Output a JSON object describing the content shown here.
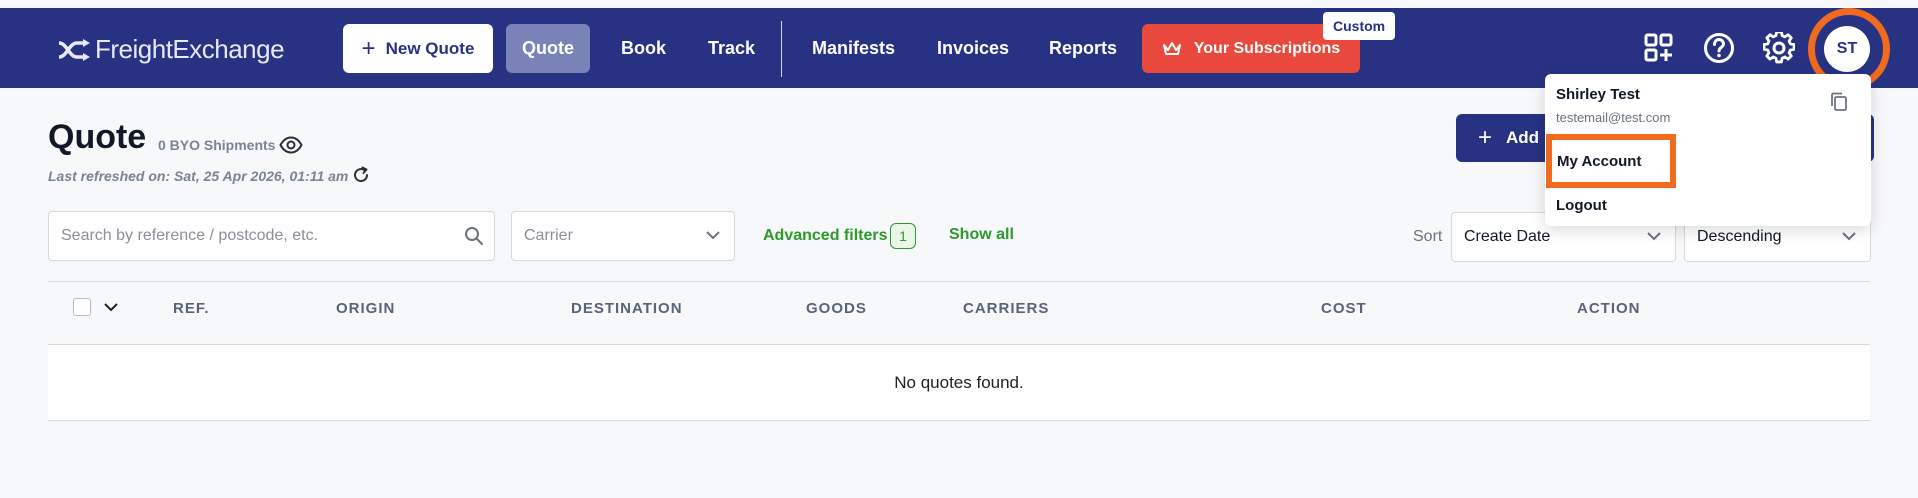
{
  "navbar": {
    "logo_text": "FreightExchange",
    "new_quote_label": "New Quote",
    "items": [
      {
        "label": "Quote",
        "active": true
      },
      {
        "label": "Book"
      },
      {
        "label": "Track"
      },
      {
        "label": "Manifests"
      },
      {
        "label": "Invoices"
      },
      {
        "label": "Reports"
      }
    ],
    "subscriptions_label": "Your Subscriptions",
    "custom_badge": "Custom",
    "icons": [
      "apps-add-icon",
      "help-icon",
      "gear-icon"
    ],
    "avatar_initials": "ST",
    "colors": {
      "bar": "#273283",
      "subscriptions": "#e9493c",
      "highlight": "#f06a1f"
    }
  },
  "page": {
    "title": "Quote",
    "byo_count": "0 BYO Shipments",
    "last_refreshed": "Last refreshed on: Sat, 25 Apr 2026, 01:11 am",
    "add_button_label": "Add"
  },
  "filters": {
    "search_placeholder": "Search by reference / postcode, etc.",
    "carrier_placeholder": "Carrier",
    "advanced_filters_label": "Advanced filters",
    "advanced_filters_count": "1",
    "show_all_label": "Show all",
    "sort_label": "Sort",
    "sort_field": "Create Date",
    "sort_order": "Descending"
  },
  "table": {
    "columns": [
      "REF.",
      "ORIGIN",
      "DESTINATION",
      "GOODS",
      "CARRIERS",
      "COST",
      "ACTION"
    ],
    "empty_message": "No quotes found."
  },
  "user_menu": {
    "name": "Shirley Test",
    "email": "testemail@test.com",
    "items": [
      "My Account",
      "Logout"
    ]
  }
}
